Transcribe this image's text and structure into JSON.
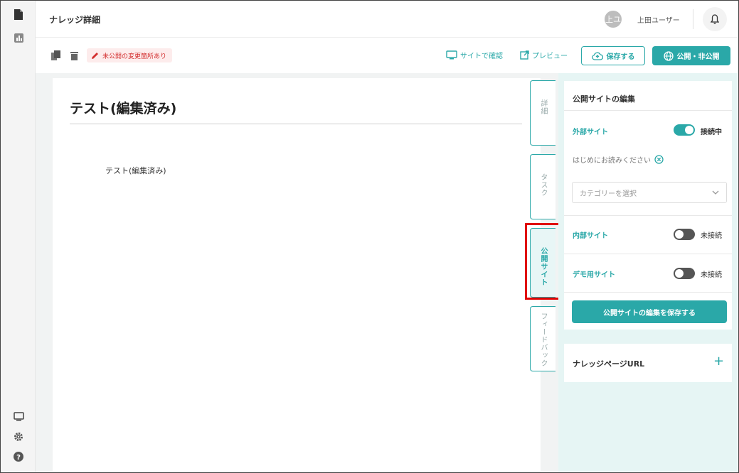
{
  "header": {
    "title": "ナレッジ詳細",
    "avatar_initials": "上ユ",
    "user_name": "上田ユーザー"
  },
  "toolbar": {
    "unpublished_badge": "未公開の変更箇所あり",
    "view_site_label": "サイトで確認",
    "preview_label": "プレビュー",
    "save_label": "保存する",
    "publish_label": "公開・非公開"
  },
  "document": {
    "title": "テスト(編集済み)",
    "body": "テスト(編集済み)"
  },
  "tabs": [
    {
      "label": "詳細",
      "active": false
    },
    {
      "label": "タスク",
      "active": false
    },
    {
      "label": "公開サイト",
      "active": true
    },
    {
      "label": "フィードバック",
      "active": false
    }
  ],
  "panel": {
    "heading": "公開サイトの編集",
    "sites": [
      {
        "label": "外部サイト",
        "status": "接続中",
        "on": true
      },
      {
        "label": "内部サイト",
        "status": "未接続",
        "on": false
      },
      {
        "label": "デモ用サイト",
        "status": "未接続",
        "on": false
      }
    ],
    "readme_label": "はじめにお読みください",
    "category_placeholder": "カテゴリーを選択",
    "save_button": "公開サイトの編集を保存する",
    "url_label": "ナレッジページURL",
    "url_add": "+"
  },
  "colors": {
    "accent": "#2aa8a8",
    "badge_text": "#d32f2f",
    "badge_bg": "#fdecec",
    "highlight": "#e00000"
  }
}
